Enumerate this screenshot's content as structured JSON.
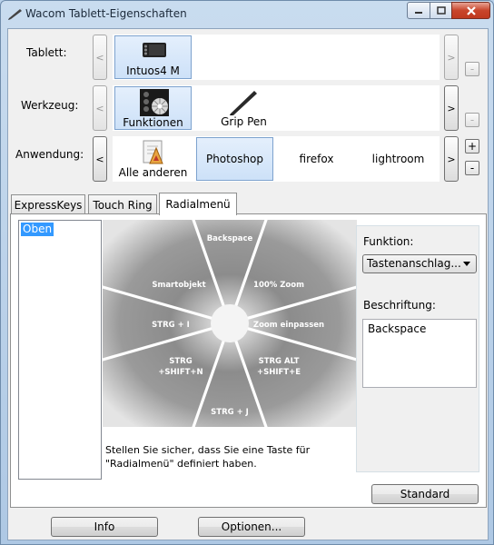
{
  "window": {
    "title": "Wacom Tablett-Eigenschaften"
  },
  "tablet": {
    "label": "Tablett:",
    "items": [
      {
        "name": "Intuos4 M"
      }
    ],
    "nav_left": "<",
    "nav_right": ">",
    "minus": "-"
  },
  "tool": {
    "label": "Werkzeug:",
    "items": [
      {
        "name": "Funktionen"
      },
      {
        "name": "Grip Pen"
      }
    ],
    "nav_left": "<",
    "nav_right": ">",
    "minus": "-"
  },
  "application": {
    "label": "Anwendung:",
    "items": [
      {
        "name": "Alle anderen"
      },
      {
        "name": "Photoshop"
      },
      {
        "name": "firefox"
      },
      {
        "name": "lightroom"
      }
    ],
    "nav_left": "<",
    "nav_right": ">",
    "plus": "+",
    "minus": "-"
  },
  "tabs": [
    {
      "label": "ExpressKeys"
    },
    {
      "label": "Touch Ring"
    },
    {
      "label": "Radialmenü"
    }
  ],
  "menu_list": {
    "items": [
      "Oben"
    ]
  },
  "radial_menu": {
    "segments": [
      "Backspace",
      "100% Zoom",
      "Zoom einpassen",
      "STRG ALT\n+SHIFT+E",
      "STRG + J",
      "STRG\n+SHIFT+N",
      "STRG + I",
      "Smartobjekt"
    ]
  },
  "notice": "Stellen Sie sicher, dass Sie eine Taste für \"Radialmenü\" definiert haben.",
  "function": {
    "label": "Funktion:",
    "value": "Tastenanschlag..."
  },
  "caption": {
    "label": "Beschriftung:",
    "value": "Backspace"
  },
  "buttons": {
    "standard": "Standard",
    "info": "Info",
    "options": "Optionen..."
  },
  "colors": {
    "selection": "#3399ff",
    "titlebar": "#c9dcef",
    "close": "#c8452b"
  }
}
